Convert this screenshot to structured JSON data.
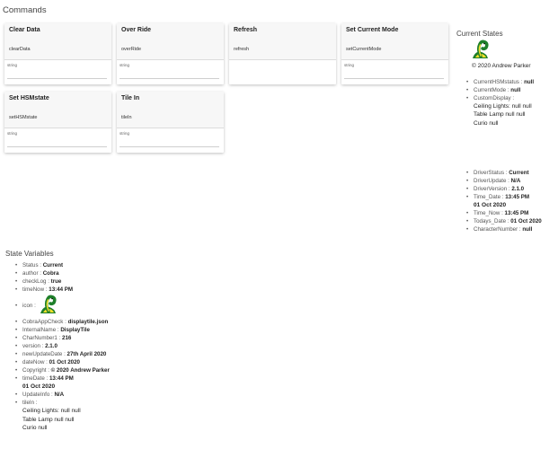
{
  "commands": {
    "title": "Commands",
    "cards": [
      {
        "title": "Clear Data",
        "method": "clearData",
        "input_hint": "string"
      },
      {
        "title": "Over Ride",
        "method": "overRide",
        "input_hint": "string"
      },
      {
        "title": "Refresh",
        "method": "refresh",
        "input_hint": ""
      },
      {
        "title": "Set Current Mode",
        "method": "setCurrentMode",
        "input_hint": "string"
      },
      {
        "title": "Set HSMstate",
        "method": "setHSMstate",
        "input_hint": "string"
      },
      {
        "title": "Tile In",
        "method": "tileIn",
        "input_hint": "string"
      }
    ]
  },
  "current_states": {
    "title": "Current States",
    "copyright": "© 2020 Andrew Parker",
    "items": [
      {
        "key": "CurrentHSMstatus",
        "value": "null"
      },
      {
        "key": "CurrentMode",
        "value": "null"
      },
      {
        "key": "CustomDisplay",
        "value": ""
      }
    ],
    "custom_display_lines": [
      "Ceiling Lights: null null",
      "Table Lamp null null",
      "Curio null"
    ],
    "items2": [
      {
        "key": "DriverStatus",
        "value": "Current"
      },
      {
        "key": "DriverUpdate",
        "value": "N/A"
      },
      {
        "key": "DriverVersion",
        "value": "2.1.0"
      },
      {
        "key": "Time_Date",
        "value": "13:45 PM"
      },
      {
        "key": "Time_Now",
        "value": "13:45 PM"
      },
      {
        "key": "Todays_Date",
        "value": "01 Oct 2020"
      },
      {
        "key": "CharacterNumber",
        "value": "null"
      }
    ],
    "time_date_extra": "01 Oct 2020"
  },
  "state_variables": {
    "title": "State Variables",
    "items": [
      {
        "key": "Status",
        "value": "Current"
      },
      {
        "key": "author",
        "value": "Cobra"
      },
      {
        "key": "checkLog",
        "value": "true"
      },
      {
        "key": "timeNow",
        "value": "13:44 PM"
      }
    ],
    "icon_key": "icon",
    "items2": [
      {
        "key": "CobraAppCheck",
        "value": "displaytile.json"
      },
      {
        "key": "InternalName",
        "value": "DisplayTile"
      },
      {
        "key": "CharNumber1",
        "value": "216"
      },
      {
        "key": "version",
        "value": "2.1.0"
      },
      {
        "key": "newUpdateDate",
        "value": "27th April 2020"
      },
      {
        "key": "dateNow",
        "value": "01 Oct 2020"
      },
      {
        "key": "Copyright",
        "value": "© 2020 Andrew Parker"
      },
      {
        "key": "timeDate",
        "value": "13:44 PM"
      }
    ],
    "time_date_extra": "01 Oct 2020",
    "update_info": {
      "key": "UpdateInfo",
      "value": "N/A"
    },
    "tile_in": {
      "key": "tileIn",
      "value": ""
    },
    "tile_in_lines": [
      "Ceiling Lights: null null",
      "Table Lamp null null",
      "Curio null"
    ]
  },
  "icons": {
    "logo": "cobra-logo-icon"
  }
}
